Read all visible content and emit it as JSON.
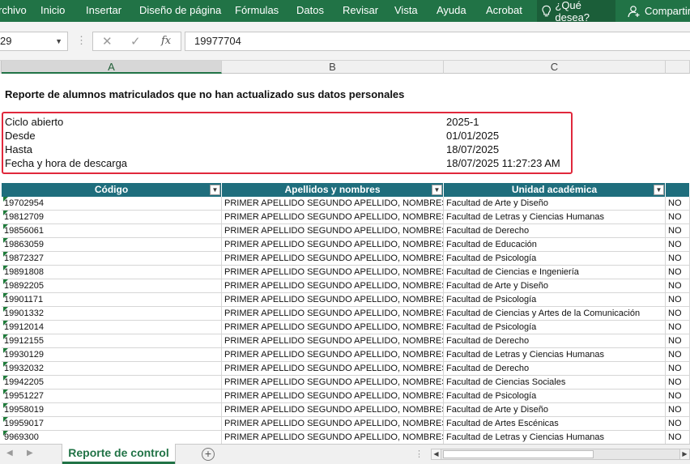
{
  "ribbon": {
    "tabs": [
      "rchivo",
      "Inicio",
      "Insertar",
      "Diseño de página",
      "Fórmulas",
      "Datos",
      "Revisar",
      "Vista",
      "Ayuda",
      "Acrobat"
    ],
    "tell_me": "¿Qué desea?",
    "share": "Compartir"
  },
  "formula_bar": {
    "name_box": "29",
    "value": "19977704"
  },
  "columns": [
    "A",
    "B",
    "C"
  ],
  "report": {
    "title": "Reporte de alumnos matriculados que no han actualizado sus datos personales",
    "fields": [
      {
        "label": "Ciclo abierto",
        "value": "2025-1"
      },
      {
        "label": "Desde",
        "value": "01/01/2025"
      },
      {
        "label": "Hasta",
        "value": "18/07/2025"
      },
      {
        "label": "Fecha y hora de descarga",
        "value": "18/07/2025 11:27:23 AM"
      }
    ]
  },
  "table": {
    "headers": [
      "Código",
      "Apellidos y nombres",
      "Unidad académica"
    ],
    "rows": [
      {
        "code": "19702954",
        "name": "PRIMER APELLIDO SEGUNDO APELLIDO, NOMBRES",
        "unit": "Facultad de Arte y Diseño",
        "flag": "NO"
      },
      {
        "code": "19812709",
        "name": "PRIMER APELLIDO SEGUNDO APELLIDO, NOMBRES",
        "unit": "Facultad de Letras y Ciencias Humanas",
        "flag": "NO"
      },
      {
        "code": "19856061",
        "name": "PRIMER APELLIDO SEGUNDO APELLIDO, NOMBRES",
        "unit": "Facultad de Derecho",
        "flag": "NO"
      },
      {
        "code": "19863059",
        "name": "PRIMER APELLIDO SEGUNDO APELLIDO, NOMBRES",
        "unit": "Facultad de Educación",
        "flag": "NO"
      },
      {
        "code": "19872327",
        "name": "PRIMER APELLIDO SEGUNDO APELLIDO, NOMBRES",
        "unit": "Facultad de Psicología",
        "flag": "NO"
      },
      {
        "code": "19891808",
        "name": "PRIMER APELLIDO SEGUNDO APELLIDO, NOMBRES",
        "unit": "Facultad de Ciencias e Ingeniería",
        "flag": "NO"
      },
      {
        "code": "19892205",
        "name": "PRIMER APELLIDO SEGUNDO APELLIDO, NOMBRES",
        "unit": "Facultad de Arte y Diseño",
        "flag": "NO"
      },
      {
        "code": "19901171",
        "name": "PRIMER APELLIDO SEGUNDO APELLIDO, NOMBRES",
        "unit": "Facultad de Psicología",
        "flag": "NO"
      },
      {
        "code": "19901332",
        "name": "PRIMER APELLIDO SEGUNDO APELLIDO, NOMBRES",
        "unit": "Facultad de Ciencias y Artes de la Comunicación",
        "flag": "NO"
      },
      {
        "code": "19912014",
        "name": "PRIMER APELLIDO SEGUNDO APELLIDO, NOMBRES",
        "unit": "Facultad de Psicología",
        "flag": "NO"
      },
      {
        "code": "19912155",
        "name": "PRIMER APELLIDO SEGUNDO APELLIDO, NOMBRES",
        "unit": "Facultad de Derecho",
        "flag": "NO"
      },
      {
        "code": "19930129",
        "name": "PRIMER APELLIDO SEGUNDO APELLIDO, NOMBRES",
        "unit": "Facultad de Letras y Ciencias Humanas",
        "flag": "NO"
      },
      {
        "code": "19932032",
        "name": "PRIMER APELLIDO SEGUNDO APELLIDO, NOMBRES",
        "unit": "Facultad de Derecho",
        "flag": "NO"
      },
      {
        "code": "19942205",
        "name": "PRIMER APELLIDO SEGUNDO APELLIDO, NOMBRES",
        "unit": "Facultad de Ciencias Sociales",
        "flag": "NO"
      },
      {
        "code": "19951227",
        "name": "PRIMER APELLIDO SEGUNDO APELLIDO, NOMBRES",
        "unit": "Facultad de Psicología",
        "flag": "NO"
      },
      {
        "code": "19958019",
        "name": "PRIMER APELLIDO SEGUNDO APELLIDO, NOMBRES",
        "unit": "Facultad de Arte y Diseño",
        "flag": "NO"
      },
      {
        "code": "19959017",
        "name": "PRIMER APELLIDO SEGUNDO APELLIDO, NOMBRES",
        "unit": "Facultad de Artes Escénicas",
        "flag": "NO"
      },
      {
        "code": "9969300",
        "name": "PRIMER APELLIDO SEGUNDO APELLIDO, NOMBRES",
        "unit": "Facultad de Letras y Ciencias Humanas",
        "flag": "NO"
      }
    ]
  },
  "sheets": {
    "active": "Reporte de control"
  },
  "colors": {
    "ribbon": "#217346",
    "table_header": "#1f6e7d",
    "highlight_box": "#e0283c"
  },
  "icons": {
    "tell_me": "lightbulb-icon",
    "share": "person-add-icon",
    "add_sheet": "plus-circle-icon"
  }
}
